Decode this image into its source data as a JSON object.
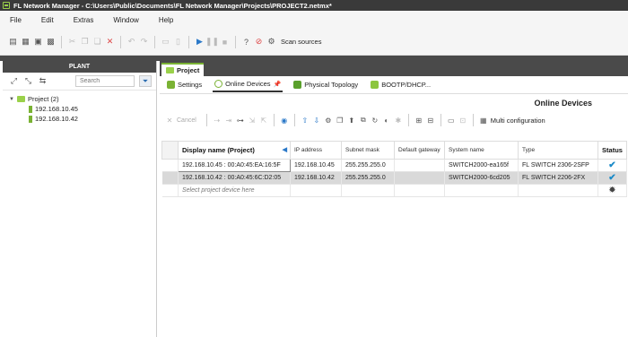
{
  "window": {
    "title": "FL Network Manager - C:\\Users\\Public\\Documents\\FL Network Manager\\Projects\\PROJECT2.netmx*"
  },
  "menu": [
    "File",
    "Edit",
    "Extras",
    "Window",
    "Help"
  ],
  "toolbar": {
    "scan_label": "Scan sources"
  },
  "plant": {
    "header": "PLANT",
    "search_placeholder": "Search",
    "tree": {
      "root": "Project (2)",
      "children": [
        "192.168.10.45",
        "192.168.10.42"
      ]
    }
  },
  "project_tab": "Project",
  "subtabs": [
    "Settings",
    "Online Devices",
    "Physical Topology",
    "BOOTP/DHCP..."
  ],
  "online_devices": {
    "title": "Online Devices",
    "cancel_label": "Cancel",
    "multi_config_label": "Multi configuration",
    "columns": [
      "Display name (Project)",
      "IP address",
      "Subnet mask",
      "Default gateway",
      "System name",
      "Type",
      "Status"
    ],
    "rows": [
      {
        "display": "192.168.10.45 : 00:A0:45:EA:16:5F",
        "ip": "192.168.10.45",
        "mask": "255.255.255.0",
        "gateway": "",
        "sysname": "SWITCH2000-ea165f",
        "type": "FL SWITCH 2306-2SFP",
        "status": "ok"
      },
      {
        "display": "192.168.10.42 : 00:A0:45:6C:D2:05",
        "ip": "192.168.10.42",
        "mask": "255.255.255.0",
        "gateway": "",
        "sysname": "SWITCH2000-6cd205",
        "type": "FL SWITCH 2206-2FX",
        "status": "ok"
      }
    ],
    "new_row_placeholder": "Select project device here"
  },
  "colors": {
    "accent": "#7ab234",
    "titlebar": "#3a3a3a",
    "status_ok": "#1a8ac8"
  }
}
